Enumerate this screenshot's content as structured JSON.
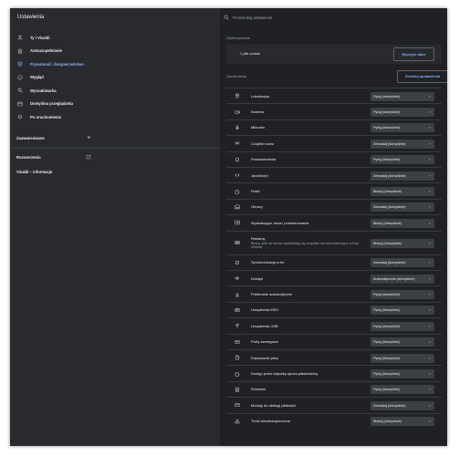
{
  "app": {
    "title": "Ustawienia"
  },
  "search": {
    "placeholder": "Przeszukaj ustawienia"
  },
  "sidebar": {
    "items": [
      {
        "label": "Ty i Vivaldi",
        "icon": "person-icon"
      },
      {
        "label": "Autouzupełnianie",
        "icon": "clipboard-icon"
      },
      {
        "label": "Prywatność i bezpieczeństwo",
        "icon": "shield-icon",
        "active": true
      },
      {
        "label": "Wygląd",
        "icon": "palette-icon"
      },
      {
        "label": "Wyszukiwarka",
        "icon": "search-icon"
      },
      {
        "label": "Domyślna przeglądarka",
        "icon": "browser-icon"
      },
      {
        "label": "Po uruchomieniu",
        "icon": "power-icon"
      }
    ],
    "advanced": "Zaawansowane",
    "extensions": "Rozszerzenia",
    "about": "Vivaldi – informacje"
  },
  "usage": {
    "section_title": "Wykorzystanie",
    "cookies_text": "1 plik cookie",
    "clear_button": "Wyczyść dane"
  },
  "permissions": {
    "section_title": "Uprawnienia",
    "reset_button": "Zresetuj uprawnienia",
    "rows": [
      {
        "label": "Lokalizacja",
        "value": "Pytaj (domyślnie)",
        "icon": "location-icon"
      },
      {
        "label": "Kamera",
        "value": "Pytaj (domyślnie)",
        "icon": "camera-icon"
      },
      {
        "label": "Mikrofon",
        "value": "Pytaj (domyślnie)",
        "icon": "microphone-icon"
      },
      {
        "label": "Czujniki ruchu",
        "value": "Zezwalaj (domyślnie)",
        "icon": "sensors-icon"
      },
      {
        "label": "Powiadomienia",
        "value": "Pytaj (domyślnie)",
        "icon": "bell-icon"
      },
      {
        "label": "JavaScript",
        "value": "Zezwalaj (domyślnie)",
        "icon": "code-icon"
      },
      {
        "label": "Flash",
        "value": "Blokuj (domyślnie)",
        "icon": "puzzle-icon"
      },
      {
        "label": "Obrazy",
        "value": "Zezwalaj (domyślnie)",
        "icon": "image-icon"
      },
      {
        "label": "Wyskakujące okna i przekierowania",
        "value": "Blokuj (domyślnie)",
        "icon": "popup-icon"
      },
      {
        "label": "Reklamy",
        "sub": "Blokuj, jeśli na stronie wyświetlają się uciążliwe lub wprowadzające w błąd reklamy",
        "value": "Blokuj (domyślnie)",
        "icon": "ads-icon"
      },
      {
        "label": "Synchronizacja w tle",
        "value": "Zezwalaj (domyślnie)",
        "icon": "sync-icon"
      },
      {
        "label": "Dźwięk",
        "value": "Automatycznie (domyślnie)",
        "icon": "speaker-icon"
      },
      {
        "label": "Pobieranie automatyczne",
        "value": "Pytaj (domyślnie)",
        "icon": "download-icon"
      },
      {
        "label": "Urządzenia MIDI",
        "value": "Pytaj (domyślnie)",
        "icon": "midi-icon"
      },
      {
        "label": "Urządzenia USB",
        "value": "Pytaj (domyślnie)",
        "icon": "usb-icon"
      },
      {
        "label": "Porty szeregowe",
        "value": "Pytaj (domyślnie)",
        "icon": "serial-port-icon"
      },
      {
        "label": "Edytowanie pliku",
        "value": "Pytaj (domyślnie)",
        "icon": "file-edit-icon"
      },
      {
        "label": "Dostęp przez wtyczkę spoza piaskownicy",
        "value": "Pytaj (domyślnie)",
        "icon": "plugin-icon"
      },
      {
        "label": "Schowek",
        "value": "Pytaj (domyślnie)",
        "icon": "clipboard-icon"
      },
      {
        "label": "Moduły do obsługi płatności",
        "value": "Zezwalaj (domyślnie)",
        "icon": "payment-icon"
      },
      {
        "label": "Treść niezabezpieczona",
        "value": "Blokuj (domyślnie)",
        "icon": "warning-icon"
      }
    ]
  },
  "colors": {
    "accent": "#8ab4f8",
    "sidebar_bg": "#292a2d",
    "main_bg": "#202124",
    "text": "#e8eaed",
    "muted": "#9aa0a6"
  }
}
